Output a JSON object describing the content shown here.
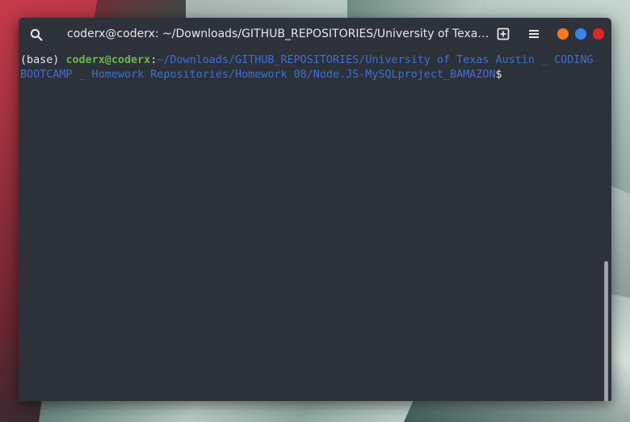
{
  "window": {
    "title": "coderx@coderx: ~/Downloads/GITHUB_REPOSITORIES/University of Texa…"
  },
  "icons": {
    "search": "search-icon",
    "new_tab": "new-tab-icon",
    "menu": "hamburger-menu-icon"
  },
  "colors": {
    "minimize": "#f37a1f",
    "maximize": "#3c82f0",
    "close": "#e0262a",
    "prompt_user": "#6bb84a",
    "prompt_path": "#3f6fd0",
    "terminal_bg": "#2c313a"
  },
  "terminal": {
    "env": "(base) ",
    "user_host": "coderx@coderx",
    "separator": ":",
    "path": "~/Downloads/GITHUB_REPOSITORIES/University of Texas Austin _ CODING BOOTCAMP _ Homework Repositories/Homework 08/Node.JS-MySQLproject_BAMAZON",
    "prompt_symbol": "$"
  }
}
